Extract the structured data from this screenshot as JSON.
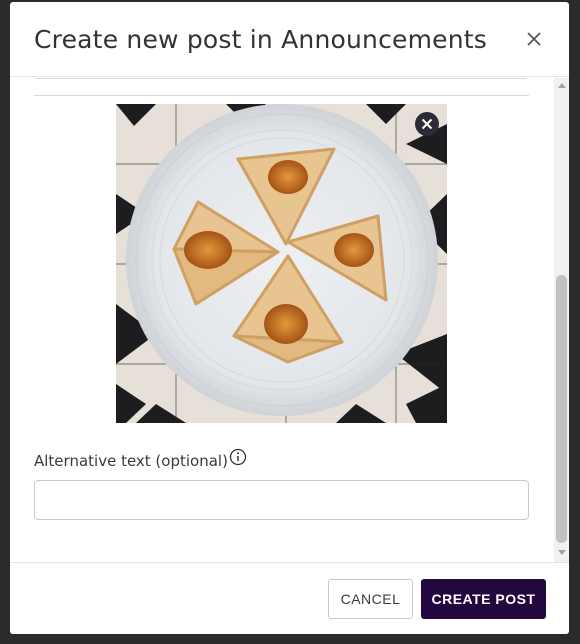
{
  "modal": {
    "title": "Create new post in Announcements",
    "close_icon": "close-icon"
  },
  "image": {
    "remove_icon": "remove-image-icon"
  },
  "alt_text": {
    "label": "Alternative text (optional)",
    "info_icon": "info-icon",
    "value": "",
    "placeholder": ""
  },
  "footer": {
    "cancel_label": "CANCEL",
    "create_label": "CREATE POST"
  },
  "colors": {
    "primary_button": "#23083f",
    "overlay": "#2b2b2b"
  }
}
